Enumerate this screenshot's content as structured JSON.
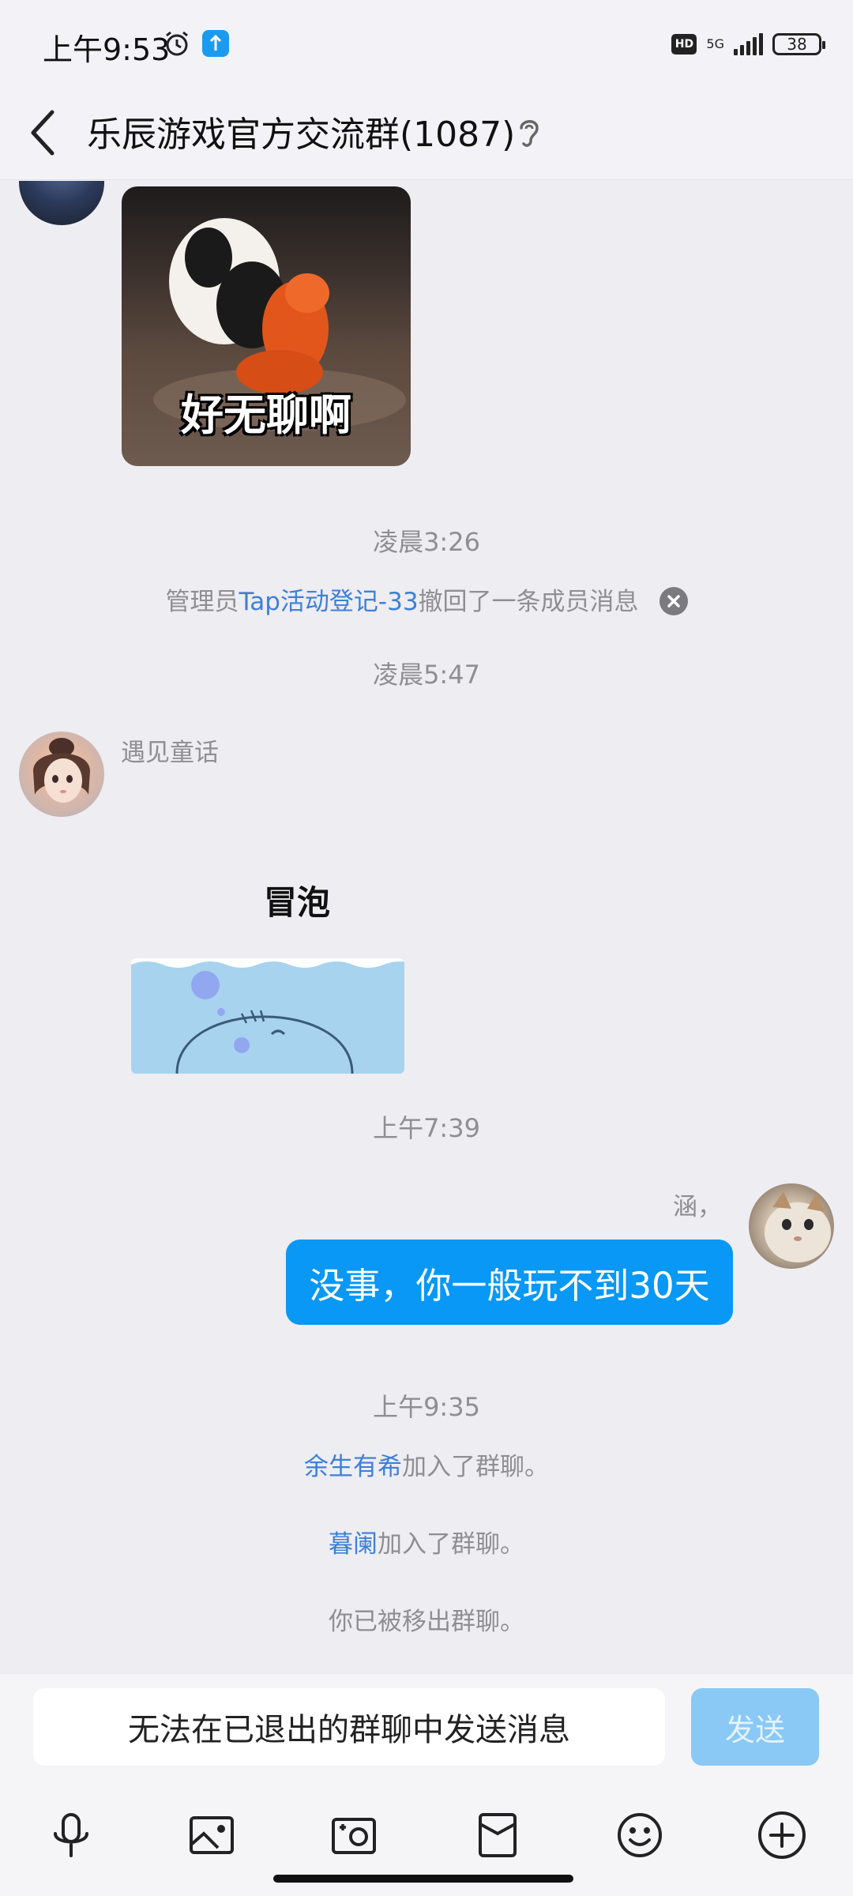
{
  "status_bar": {
    "time": "上午9:53",
    "hd": "HD",
    "network": "5G",
    "battery": "38",
    "signal_bars": 4
  },
  "header": {
    "title": "乐辰游戏官方交流群(1087)"
  },
  "messages": {
    "panda_sticker_text": "好无聊啊",
    "time1": "凌晨3:26",
    "recall": {
      "prefix": "管理员",
      "admin": "Tap活动登记-33",
      "suffix": "撤回了一条成员消息"
    },
    "time2": "凌晨5:47",
    "sender1": "遇见童话",
    "sticker2_text": "冒泡",
    "time3": "上午7:39",
    "sender2": "涵，",
    "bubble_text": "没事，你一般玩不到30天",
    "time4": "上午9:35",
    "join1": {
      "name": "余生有希",
      "text": "加入了群聊。"
    },
    "join2": {
      "name": "暮阑",
      "text": "加入了群聊。"
    },
    "removed": "你已被移出群聊。"
  },
  "input": {
    "placeholder": "无法在已退出的群聊中发送消息",
    "send_label": "发送"
  },
  "colors": {
    "accent": "#0998f5",
    "link": "#3d7fd9",
    "send_disabled": "#8ac8f5"
  },
  "toolbar_icons": [
    "microphone-icon",
    "image-icon",
    "camera-icon",
    "red-packet-icon",
    "emoji-icon",
    "plus-icon"
  ]
}
